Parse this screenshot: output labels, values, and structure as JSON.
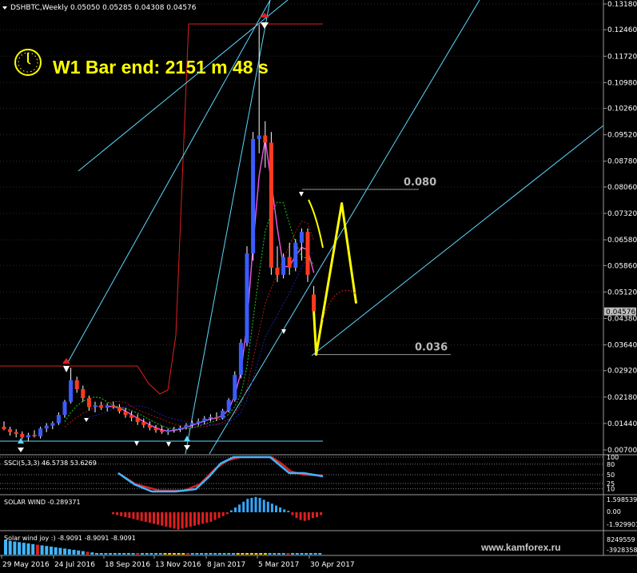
{
  "header": {
    "symbol_text": "DSHBTC,Weekly  0.05050 0.05285 0.04308 0.04576"
  },
  "timer": {
    "text": "W1 Bar end: 2151 m 48 s",
    "icon": "clock-icon"
  },
  "levels": [
    {
      "label": "0.080",
      "price": 0.0799
    },
    {
      "label": "0.036",
      "price": 0.0337
    }
  ],
  "price_axis": {
    "ticks": [
      "0.13180",
      "0.12460",
      "0.11720",
      "0.10980",
      "0.10260",
      "0.09520",
      "0.08780",
      "0.08060",
      "0.07320",
      "0.06580",
      "0.05860",
      "0.05120",
      "0.04380",
      "0.03640",
      "0.02920",
      "0.02180",
      "0.01440",
      "0.00700"
    ],
    "current": "0.04576",
    "current_value": 0.04576,
    "current_bg": "#c0c0c0"
  },
  "panels": {
    "stoch": {
      "label": "SSCl(5,3,3) 46.5738 53.6269",
      "ticks": [
        "100",
        "80",
        "50",
        "25",
        "10"
      ]
    },
    "solar": {
      "label": "SOLAR WIND -0.289371",
      "ticks": [
        "1.598539",
        "0.00",
        "-1.929901"
      ]
    },
    "joy": {
      "label": "Solar wind joy :) -8.9091 -8.9091 -8.9091",
      "ticks": [
        "8249559",
        "-3928358"
      ]
    }
  },
  "date_axis": [
    "29 May 2016",
    "24 Jul 2016",
    "18 Sep 2016",
    "13 Nov 2016",
    "8 Jan 2017",
    "5 Mar 2017",
    "30 Apr 2017"
  ],
  "watermark": "www.kamforex.ru",
  "colors": {
    "bull": "#3a5cff",
    "bear": "#ff3a1e",
    "channel": "#e01e1e",
    "trend": "#5ed8ff",
    "projection": "#ffff00",
    "ma_fast": "#ff3ad6"
  },
  "chart_data": {
    "type": "candlestick",
    "timeframe": "Weekly",
    "symbol": "DSHBTC",
    "last_bar": {
      "open": 0.0505,
      "high": 0.05285,
      "low": 0.04308,
      "close": 0.04576
    },
    "ylim": [
      0.007,
      0.1318
    ],
    "candles": [
      [
        0.0135,
        0.015,
        0.0125,
        0.0128
      ],
      [
        0.0128,
        0.0135,
        0.011,
        0.012
      ],
      [
        0.012,
        0.0128,
        0.0105,
        0.0115
      ],
      [
        0.0115,
        0.0122,
        0.01,
        0.0105
      ],
      [
        0.0105,
        0.0118,
        0.0095,
        0.0112
      ],
      [
        0.0112,
        0.0125,
        0.0105,
        0.0108
      ],
      [
        0.0108,
        0.0135,
        0.0102,
        0.013
      ],
      [
        0.013,
        0.0145,
        0.012,
        0.0138
      ],
      [
        0.0138,
        0.015,
        0.0128,
        0.0145
      ],
      [
        0.0145,
        0.0175,
        0.014,
        0.0168
      ],
      [
        0.0168,
        0.021,
        0.016,
        0.0205
      ],
      [
        0.0205,
        0.03,
        0.02,
        0.0265
      ],
      [
        0.0265,
        0.0275,
        0.023,
        0.024
      ],
      [
        0.024,
        0.025,
        0.0205,
        0.0215
      ],
      [
        0.0215,
        0.0222,
        0.018,
        0.019
      ],
      [
        0.019,
        0.0205,
        0.0175,
        0.0195
      ],
      [
        0.0195,
        0.0205,
        0.0182,
        0.0188
      ],
      [
        0.0188,
        0.02,
        0.0178,
        0.0195
      ],
      [
        0.0195,
        0.0205,
        0.0185,
        0.019
      ],
      [
        0.019,
        0.0198,
        0.0172,
        0.0178
      ],
      [
        0.0178,
        0.0188,
        0.016,
        0.0168
      ],
      [
        0.0168,
        0.0178,
        0.015,
        0.016
      ],
      [
        0.016,
        0.017,
        0.014,
        0.0148
      ],
      [
        0.0148,
        0.0158,
        0.0132,
        0.014
      ],
      [
        0.014,
        0.015,
        0.0125,
        0.0132
      ],
      [
        0.0132,
        0.014,
        0.0118,
        0.0125
      ],
      [
        0.0125,
        0.0138,
        0.0115,
        0.012
      ],
      [
        0.012,
        0.013,
        0.0112,
        0.0125
      ],
      [
        0.0125,
        0.0135,
        0.0118,
        0.0128
      ],
      [
        0.0128,
        0.0138,
        0.012,
        0.0132
      ],
      [
        0.0132,
        0.0145,
        0.0128,
        0.014
      ],
      [
        0.014,
        0.0152,
        0.0132,
        0.0145
      ],
      [
        0.0145,
        0.0158,
        0.0138,
        0.015
      ],
      [
        0.015,
        0.0165,
        0.0142,
        0.0158
      ],
      [
        0.0158,
        0.017,
        0.015,
        0.0162
      ],
      [
        0.0162,
        0.0175,
        0.0152,
        0.0158
      ],
      [
        0.0158,
        0.0185,
        0.0155,
        0.018
      ],
      [
        0.018,
        0.0215,
        0.0175,
        0.021
      ],
      [
        0.021,
        0.029,
        0.0205,
        0.028
      ],
      [
        0.028,
        0.038,
        0.027,
        0.037
      ],
      [
        0.037,
        0.064,
        0.036,
        0.062
      ],
      [
        0.062,
        0.096,
        0.06,
        0.094
      ],
      [
        0.094,
        0.126,
        0.09,
        0.095
      ],
      [
        0.095,
        0.099,
        0.086,
        0.093
      ],
      [
        0.093,
        0.096,
        0.056,
        0.058
      ],
      [
        0.058,
        0.064,
        0.054,
        0.056
      ],
      [
        0.056,
        0.062,
        0.055,
        0.061
      ],
      [
        0.061,
        0.065,
        0.056,
        0.058
      ],
      [
        0.058,
        0.066,
        0.057,
        0.065
      ],
      [
        0.065,
        0.069,
        0.06,
        0.068
      ],
      [
        0.068,
        0.069,
        0.054,
        0.056
      ],
      [
        0.0505,
        0.0529,
        0.0431,
        0.0458
      ]
    ],
    "projection": [
      [
        0.0458,
        0.0458
      ],
      [
        0.0337,
        0.0337
      ],
      [
        0.076,
        0.076
      ],
      [
        0.048,
        0.048
      ]
    ]
  }
}
